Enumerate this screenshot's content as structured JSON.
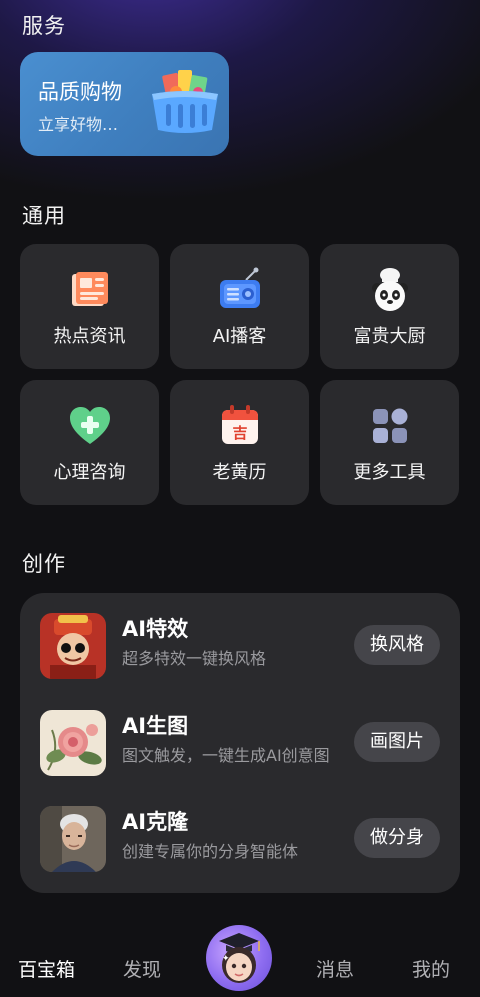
{
  "sections": {
    "service": "服务",
    "general": "通用",
    "creation": "创作"
  },
  "shop": {
    "title": "品质购物",
    "subtitle": "立享好物…"
  },
  "tiles": [
    {
      "label": "热点资讯",
      "icon": "newspaper-icon"
    },
    {
      "label": "AI播客",
      "icon": "radio-icon"
    },
    {
      "label": "富贵大厨",
      "icon": "panda-chef-icon"
    },
    {
      "label": "心理咨询",
      "icon": "heart-plus-icon"
    },
    {
      "label": "老黄历",
      "icon": "calendar-icon"
    },
    {
      "label": "更多工具",
      "icon": "grid-apps-icon"
    }
  ],
  "create": [
    {
      "title": "AI特效",
      "desc": "超多特效一键换风格",
      "button": "换风格"
    },
    {
      "title": "AI生图",
      "desc": "图文触发，一键生成AI创意图",
      "button": "画图片"
    },
    {
      "title": "AI克隆",
      "desc": "创建专属你的分身智能体",
      "button": "做分身"
    }
  ],
  "nav": {
    "items": [
      "百宝箱",
      "发现",
      "消息",
      "我的"
    ],
    "active": "百宝箱"
  },
  "colors": {
    "background": "#111114",
    "card": "#2a2a2d",
    "shop_card": "#4a8fd0",
    "button": "#45454a",
    "muted_text": "#9a9a9e"
  }
}
